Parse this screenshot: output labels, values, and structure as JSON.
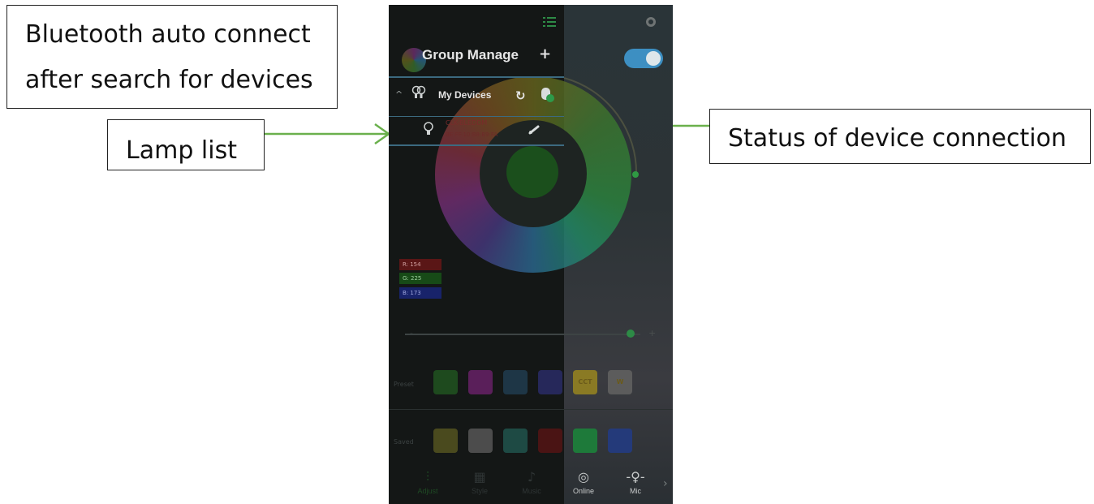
{
  "callouts": {
    "bluetooth_line1": "Bluetooth auto connect",
    "bluetooth_line2": "after search for devices",
    "lamp_list": "Lamp list",
    "device_status": "Status of device connection"
  },
  "app": {
    "header": {
      "menu_icon": "list-icon",
      "settings_icon": "gear-icon",
      "group_title": "Group Manage",
      "add_symbol": "+",
      "power_toggle": "on"
    },
    "device_group": {
      "collapse_symbol": "^",
      "label": "My Devices",
      "refresh_symbol": "↻",
      "bluetooth_icon": "bluetooth-status-icon"
    },
    "device": {
      "name": "CLK-BLEDDM",
      "mac": "BE:FF:10:B8:B9:FA",
      "connection_icon": "link-icon"
    },
    "rgb": {
      "r_label": "R: 154",
      "g_label": "G: 225",
      "b_label": "B: 173"
    },
    "slider": {
      "minus": "-",
      "plus": "+",
      "level": 0.96
    },
    "preset_row_label": "Preset",
    "preset_swatches": [
      {
        "color": "#1e4a1e",
        "label": ""
      },
      {
        "color": "#5a1f5a",
        "label": ""
      },
      {
        "color": "#1e3646",
        "label": ""
      },
      {
        "color": "#26285a",
        "label": ""
      },
      {
        "color": "#8a7a24",
        "label": "CCT"
      },
      {
        "color": "#5c5c5c",
        "label": "W"
      }
    ],
    "saved_row_label": "Saved",
    "saved_swatches": [
      {
        "color": "#4a4a1e",
        "label": ""
      },
      {
        "color": "#4c4c4c",
        "label": ""
      },
      {
        "color": "#1e4a44",
        "label": ""
      },
      {
        "color": "#4a1414",
        "label": ""
      },
      {
        "color": "#1e7a3a",
        "label": ""
      },
      {
        "color": "#243a7a",
        "label": ""
      }
    ],
    "tabs": [
      {
        "label": "Adjust",
        "icon": "sliders-icon",
        "glyph": "⫶"
      },
      {
        "label": "Style",
        "icon": "grid-icon",
        "glyph": "▦"
      },
      {
        "label": "Music",
        "icon": "music-note-icon",
        "glyph": "♪"
      },
      {
        "label": "Online",
        "icon": "timer-icon",
        "glyph": "◎"
      },
      {
        "label": "Mic",
        "icon": "microphone-icon",
        "glyph": "-♀-"
      }
    ],
    "more_symbol": "›"
  },
  "colors": {
    "accent_toggle": "#3d8fc2",
    "arrow_green": "#6ab04c",
    "divider": "#3c6a80"
  }
}
